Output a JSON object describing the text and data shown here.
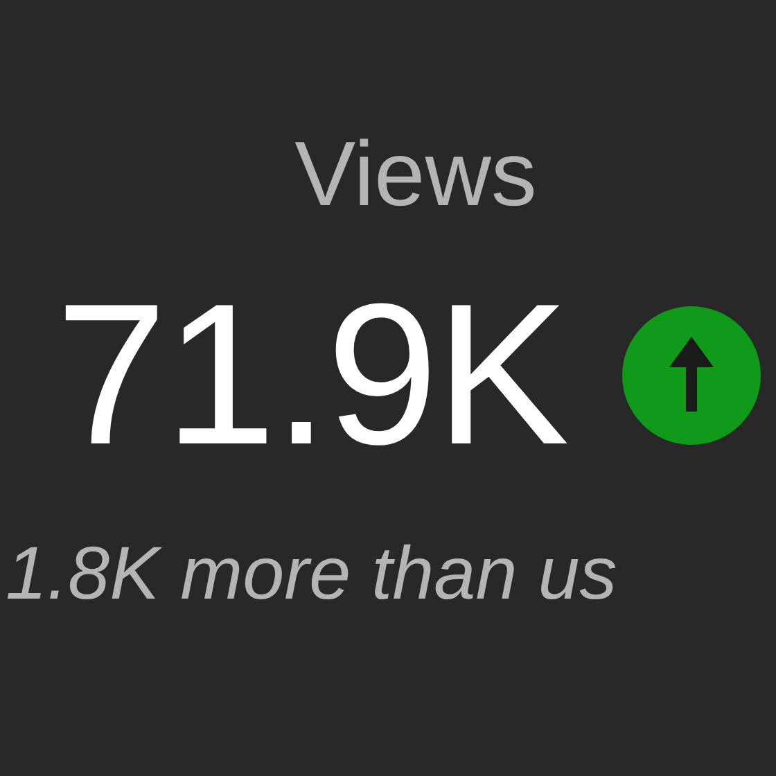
{
  "stat": {
    "label": "Views",
    "value": "71.9K",
    "increase": true,
    "comparison": "1.8K more than us"
  }
}
